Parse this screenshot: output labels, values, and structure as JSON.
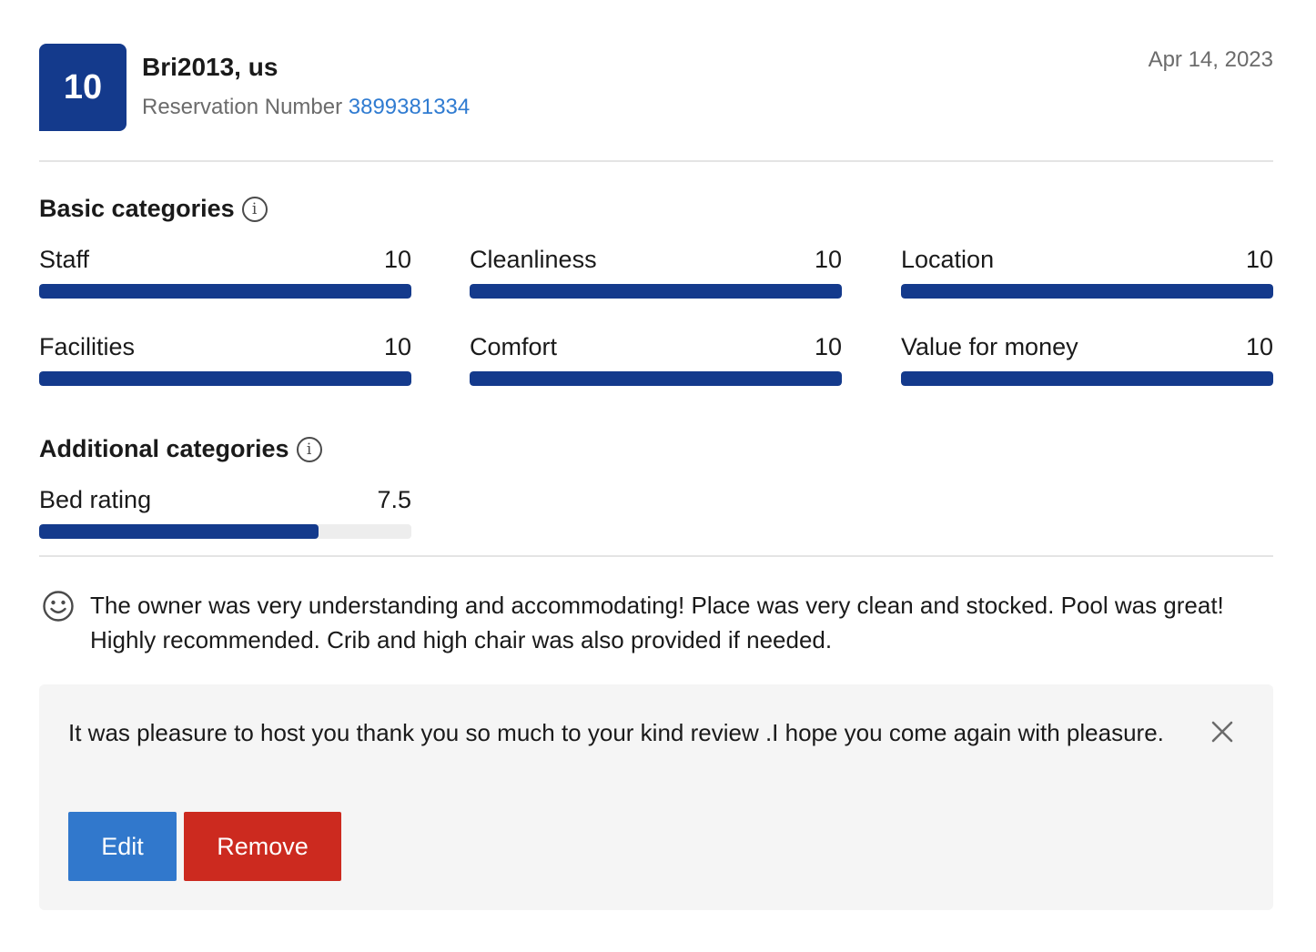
{
  "header": {
    "score": "10",
    "reviewer": "Bri2013, us",
    "reservation_label": "Reservation Number",
    "reservation_number": "3899381334",
    "date": "Apr 14, 2023"
  },
  "basic": {
    "title": "Basic categories",
    "items": [
      {
        "label": "Staff",
        "value": "10",
        "fraction": 1.0
      },
      {
        "label": "Cleanliness",
        "value": "10",
        "fraction": 1.0
      },
      {
        "label": "Location",
        "value": "10",
        "fraction": 1.0
      },
      {
        "label": "Facilities",
        "value": "10",
        "fraction": 1.0
      },
      {
        "label": "Comfort",
        "value": "10",
        "fraction": 1.0
      },
      {
        "label": "Value for money",
        "value": "10",
        "fraction": 1.0
      }
    ]
  },
  "additional": {
    "title": "Additional categories",
    "items": [
      {
        "label": "Bed rating",
        "value": "7.5",
        "fraction": 0.75
      }
    ]
  },
  "review": {
    "icon": "smile-icon",
    "text": "The owner was very understanding and accommodating! Place was very clean and stocked. Pool was great! Highly recommended. Crib and high chair was also provided if needed."
  },
  "response": {
    "text": "It was pleasure to host you thank you so much to your kind review .I hope you come again with pleasure.",
    "edit_label": "Edit",
    "remove_label": "Remove"
  },
  "colors": {
    "score_badge": "#143a8c",
    "bar_fill": "#143a8c",
    "link": "#2f7bd1",
    "edit_button": "#3178cc",
    "remove_button": "#cc2a1f"
  }
}
